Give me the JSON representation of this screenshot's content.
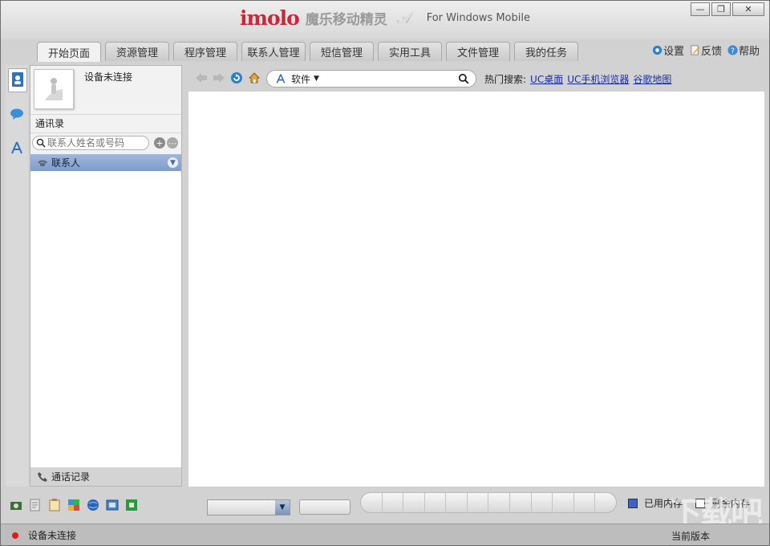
{
  "app": {
    "logo_text": "imolo",
    "name_cn": "魔乐移动精灵",
    "for_platform": "For Windows Mobile"
  },
  "window_controls": [
    "—",
    "❐",
    "✕"
  ],
  "tabs": [
    {
      "label": "开始页面",
      "active": true
    },
    {
      "label": "资源管理",
      "active": false
    },
    {
      "label": "程序管理",
      "active": false
    },
    {
      "label": "联系人管理",
      "active": false
    },
    {
      "label": "短信管理",
      "active": false
    },
    {
      "label": "实用工具",
      "active": false
    },
    {
      "label": "文件管理",
      "active": false
    },
    {
      "label": "我的任务",
      "active": false
    }
  ],
  "toplinks": {
    "settings": "设置",
    "feedback": "反馈",
    "help": "帮助"
  },
  "sidebar_strip": [
    {
      "icon": "contacts-book-icon",
      "selected": true
    },
    {
      "icon": "sms-bubble-icon",
      "selected": false
    },
    {
      "icon": "app-store-icon",
      "selected": false
    }
  ],
  "contacts_panel": {
    "device_status": "设备未连接",
    "title": "通讯录",
    "search_placeholder": "联系人姓名或号码",
    "group_label": "联系人",
    "call_log_label": "通话记录"
  },
  "browser": {
    "address_value": "软件",
    "hot_label": "热门搜索:",
    "hot_links": [
      "UC桌面",
      "UC手机浏览器",
      "谷歌地图"
    ]
  },
  "memory_legend": {
    "used_label": "已用内存",
    "free_label": "剩余内存",
    "used_color": "#3f62c8",
    "free_color": "#ffffff"
  },
  "statusbar": {
    "connection": "设备未连接",
    "version_label": "当前版本"
  },
  "colors": {
    "accent_blue": "#8aa6d4",
    "logo_red": "#c8283a",
    "status_dot": "#e21a1a"
  }
}
